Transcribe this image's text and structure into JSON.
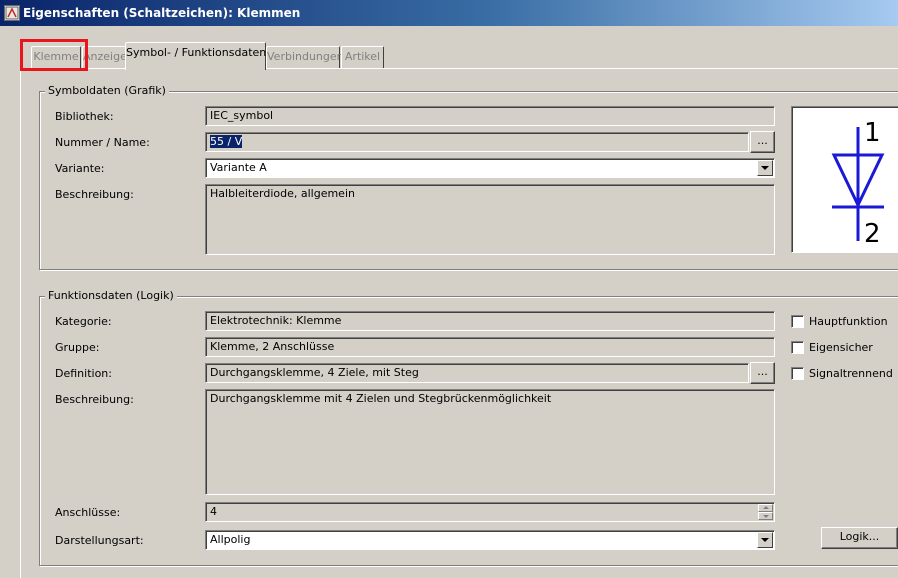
{
  "window": {
    "title": "Eigenschaften (Schaltzeichen): Klemmen",
    "icon": "app-properties-icon"
  },
  "tabs": [
    {
      "label": "Klemme",
      "active": false
    },
    {
      "label": "Anzeige",
      "active": false
    },
    {
      "label": "Symbol- / Funktionsdaten",
      "active": true
    },
    {
      "label": "Verbindungen",
      "active": false
    },
    {
      "label": "Artikel",
      "active": false
    }
  ],
  "symbol_group": {
    "title": "Symboldaten (Grafik)",
    "library_label": "Bibliothek:",
    "library_value": "IEC_symbol",
    "number_label": "Nummer / Name:",
    "number_value": "55 / V",
    "browse_label": "...",
    "variant_label": "Variante:",
    "variant_value": "Variante A",
    "description_label": "Beschreibung:",
    "description_value": "Halbleiterdiode, allgemein",
    "preview": {
      "pin_top": "1",
      "pin_bottom": "2",
      "icon": "diode-symbol-icon",
      "color": "#1a1ad6"
    }
  },
  "function_group": {
    "title": "Funktionsdaten (Logik)",
    "category_label": "Kategorie:",
    "category_value": "Elektrotechnik: Klemme",
    "group_label": "Gruppe:",
    "group_value": "Klemme, 2 Anschlüsse",
    "definition_label": "Definition:",
    "definition_value": "Durchgangsklemme, 4 Ziele, mit Steg",
    "browse_label": "...",
    "description_label": "Beschreibung:",
    "description_value": "Durchgangsklemme mit 4 Zielen und Stegbrückenmöglichkeit",
    "connections_label": "Anschlüsse:",
    "connections_value": "4",
    "display_type_label": "Darstellungsart:",
    "display_type_value": "Allpolig",
    "checkboxes": [
      {
        "label": "Hauptfunktion",
        "checked": false
      },
      {
        "label": "Eigensicher",
        "checked": false
      },
      {
        "label": "Signaltrennend",
        "checked": false
      }
    ],
    "logic_button_label": "Logik..."
  },
  "colors": {
    "dialog_background": "#d4d0c8",
    "highlight_frame": "#e8161c",
    "selection": "#0a246a"
  }
}
